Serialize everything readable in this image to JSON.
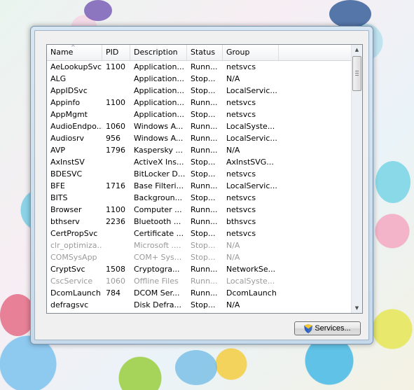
{
  "list": {
    "columns": [
      "Name",
      "PID",
      "Description",
      "Status",
      "Group"
    ],
    "sort_indicator": "^",
    "rows": [
      {
        "name": "AeLookupSvc",
        "pid": "1100",
        "desc": "Application...",
        "status": "Runn...",
        "group": "netsvcs",
        "dim": false
      },
      {
        "name": "ALG",
        "pid": "",
        "desc": "Application...",
        "status": "Stop...",
        "group": "N/A",
        "dim": false
      },
      {
        "name": "AppIDSvc",
        "pid": "",
        "desc": "Application...",
        "status": "Stop...",
        "group": "LocalServic...",
        "dim": false
      },
      {
        "name": "Appinfo",
        "pid": "1100",
        "desc": "Application...",
        "status": "Runn...",
        "group": "netsvcs",
        "dim": false
      },
      {
        "name": "AppMgmt",
        "pid": "",
        "desc": "Application...",
        "status": "Stop...",
        "group": "netsvcs",
        "dim": false
      },
      {
        "name": "AudioEndpo...",
        "pid": "1060",
        "desc": "Windows A...",
        "status": "Runn...",
        "group": "LocalSyste...",
        "dim": false
      },
      {
        "name": "Audiosrv",
        "pid": "956",
        "desc": "Windows A...",
        "status": "Runn...",
        "group": "LocalServic...",
        "dim": false
      },
      {
        "name": "AVP",
        "pid": "1796",
        "desc": "Kaspersky ...",
        "status": "Runn...",
        "group": "N/A",
        "dim": false
      },
      {
        "name": "AxInstSV",
        "pid": "",
        "desc": "ActiveX Ins...",
        "status": "Stop...",
        "group": "AxInstSVG...",
        "dim": false
      },
      {
        "name": "BDESVC",
        "pid": "",
        "desc": "BitLocker D...",
        "status": "Stop...",
        "group": "netsvcs",
        "dim": false
      },
      {
        "name": "BFE",
        "pid": "1716",
        "desc": "Base Filteri...",
        "status": "Runn...",
        "group": "LocalServic...",
        "dim": false
      },
      {
        "name": "BITS",
        "pid": "",
        "desc": "Backgroun...",
        "status": "Stop...",
        "group": "netsvcs",
        "dim": false
      },
      {
        "name": "Browser",
        "pid": "1100",
        "desc": "Computer ...",
        "status": "Runn...",
        "group": "netsvcs",
        "dim": false
      },
      {
        "name": "bthserv",
        "pid": "2236",
        "desc": "Bluetooth ...",
        "status": "Runn...",
        "group": "bthsvcs",
        "dim": false
      },
      {
        "name": "CertPropSvc",
        "pid": "",
        "desc": "Certificate ...",
        "status": "Stop...",
        "group": "netsvcs",
        "dim": false
      },
      {
        "name": "clr_optimiza...",
        "pid": "",
        "desc": "Microsoft ....",
        "status": "Stop...",
        "group": "N/A",
        "dim": true
      },
      {
        "name": "COMSysApp",
        "pid": "",
        "desc": "COM+ Sys...",
        "status": "Stop...",
        "group": "N/A",
        "dim": true
      },
      {
        "name": "CryptSvc",
        "pid": "1508",
        "desc": "Cryptogra...",
        "status": "Runn...",
        "group": "NetworkSe...",
        "dim": false
      },
      {
        "name": "CscService",
        "pid": "1060",
        "desc": "Offline Files",
        "status": "Runn...",
        "group": "LocalSyste...",
        "dim": true
      },
      {
        "name": "DcomLaunch",
        "pid": "784",
        "desc": "DCOM Ser...",
        "status": "Runn...",
        "group": "DcomLaunch",
        "dim": false
      },
      {
        "name": "defragsvc",
        "pid": "",
        "desc": "Disk Defra...",
        "status": "Stop...",
        "group": "N/A",
        "dim": false
      }
    ]
  },
  "services_button": {
    "label": "Services...",
    "icon": "uac-shield-icon"
  },
  "colors": {
    "window_frame": "#c6d9ea",
    "panel": "#f0f0f0",
    "dim_text": "#9a9a9a"
  }
}
